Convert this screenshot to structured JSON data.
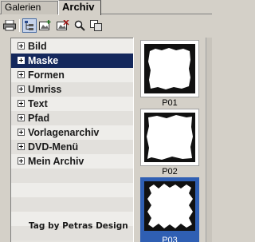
{
  "tabs": [
    {
      "label": "Galerien",
      "active": false
    },
    {
      "label": "Archiv",
      "active": true
    }
  ],
  "toolbar": {
    "buttons": [
      {
        "icon": "printer-icon"
      },
      {
        "icon": "tree-view-icon",
        "active": true
      },
      {
        "icon": "image-add-icon"
      },
      {
        "icon": "image-remove-icon"
      },
      {
        "icon": "search-icon"
      },
      {
        "icon": "copy-icon"
      }
    ]
  },
  "tree": {
    "items": [
      {
        "label": "Bild"
      },
      {
        "label": "Maske",
        "selected": true
      },
      {
        "label": "Formen"
      },
      {
        "label": "Umriss"
      },
      {
        "label": "Text"
      },
      {
        "label": "Pfad"
      },
      {
        "label": "Vorlagenarchiv"
      },
      {
        "label": "DVD-Menü"
      },
      {
        "label": "Mein Archiv"
      }
    ],
    "credit": "Tag by Petras Design"
  },
  "thumbnails": [
    {
      "caption": "P01",
      "selected": false
    },
    {
      "caption": "P02",
      "selected": false
    },
    {
      "caption": "P03",
      "selected": true
    }
  ],
  "colors": {
    "selection": "#14285c",
    "thumb_selection": "#2f5fb3",
    "panel": "#d4d0c8"
  }
}
